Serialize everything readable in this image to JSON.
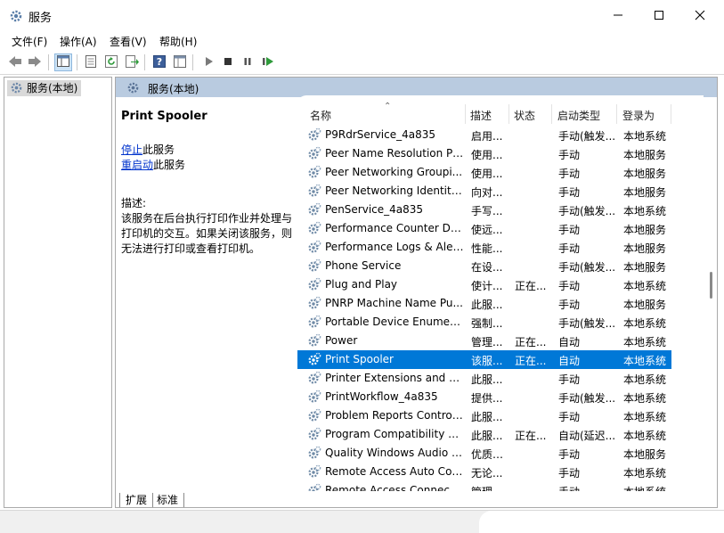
{
  "window": {
    "title": "服务",
    "minimize_icon": "minimize-icon",
    "maximize_icon": "maximize-icon",
    "close_icon": "close-icon"
  },
  "menu": [
    {
      "label": "文件(F)"
    },
    {
      "label": "操作(A)"
    },
    {
      "label": "查看(V)"
    },
    {
      "label": "帮助(H)"
    }
  ],
  "toolbar": {
    "icons": [
      "back-icon",
      "forward-icon",
      "console-tree-icon",
      "properties-icon",
      "refresh-icon",
      "export-icon",
      "help-icon",
      "view-icon",
      "start-icon",
      "stop-icon",
      "pause-icon",
      "restart-icon"
    ]
  },
  "tree": {
    "root_label": "服务(本地)"
  },
  "pane": {
    "header_title": "服务(本地)"
  },
  "description": {
    "service_name": "Print Spooler",
    "stop_link": "停止",
    "stop_suffix": "此服务",
    "restart_link": "重启动",
    "restart_suffix": "此服务",
    "desc_label": "描述:",
    "desc_lines": [
      "该服务在后台执行打印作业并处理与",
      "打印机的交互。如果关闭该服务，则",
      "无法进行打印或查看打印机。"
    ]
  },
  "columns": {
    "name": "名称",
    "description": "描述",
    "status": "状态",
    "startup": "启动类型",
    "logon": "登录为"
  },
  "services": [
    {
      "name": "P9RdrService_4a835",
      "desc": "启用...",
      "status": "",
      "startup": "手动(触发...",
      "logon": "本地系统"
    },
    {
      "name": "Peer Name Resolution Pr...",
      "desc": "使用...",
      "status": "",
      "startup": "手动",
      "logon": "本地服务"
    },
    {
      "name": "Peer Networking Groupi...",
      "desc": "使用...",
      "status": "",
      "startup": "手动",
      "logon": "本地服务"
    },
    {
      "name": "Peer Networking Identity...",
      "desc": "向对...",
      "status": "",
      "startup": "手动",
      "logon": "本地服务"
    },
    {
      "name": "PenService_4a835",
      "desc": "手写...",
      "status": "",
      "startup": "手动(触发...",
      "logon": "本地系统"
    },
    {
      "name": "Performance Counter DL...",
      "desc": "使远...",
      "status": "",
      "startup": "手动",
      "logon": "本地服务"
    },
    {
      "name": "Performance Logs & Aler...",
      "desc": "性能...",
      "status": "",
      "startup": "手动",
      "logon": "本地服务"
    },
    {
      "name": "Phone Service",
      "desc": "在设...",
      "status": "",
      "startup": "手动(触发...",
      "logon": "本地服务"
    },
    {
      "name": "Plug and Play",
      "desc": "使计...",
      "status": "正在...",
      "startup": "手动",
      "logon": "本地系统"
    },
    {
      "name": "PNRP Machine Name Pu...",
      "desc": "此服...",
      "status": "",
      "startup": "手动",
      "logon": "本地服务"
    },
    {
      "name": "Portable Device Enumera...",
      "desc": "强制...",
      "status": "",
      "startup": "手动(触发...",
      "logon": "本地系统"
    },
    {
      "name": "Power",
      "desc": "管理...",
      "status": "正在...",
      "startup": "自动",
      "logon": "本地系统"
    },
    {
      "name": "Print Spooler",
      "desc": "该服...",
      "status": "正在...",
      "startup": "自动",
      "logon": "本地系统",
      "selected": true
    },
    {
      "name": "Printer Extensions and N...",
      "desc": "此服...",
      "status": "",
      "startup": "手动",
      "logon": "本地系统"
    },
    {
      "name": "PrintWorkflow_4a835",
      "desc": "提供...",
      "status": "",
      "startup": "手动(触发...",
      "logon": "本地系统"
    },
    {
      "name": "Problem Reports Control...",
      "desc": "此服...",
      "status": "",
      "startup": "手动",
      "logon": "本地系统"
    },
    {
      "name": "Program Compatibility A...",
      "desc": "此服...",
      "status": "正在...",
      "startup": "自动(延迟...",
      "logon": "本地系统"
    },
    {
      "name": "Quality Windows Audio V...",
      "desc": "优质 ...",
      "status": "",
      "startup": "手动",
      "logon": "本地服务"
    },
    {
      "name": "Remote Access Auto Con...",
      "desc": "无论...",
      "status": "",
      "startup": "手动",
      "logon": "本地系统"
    },
    {
      "name": "Remote Access Connecti...",
      "desc": "管理...",
      "status": "",
      "startup": "手动",
      "logon": "本地系统"
    }
  ],
  "tabs": [
    {
      "label": "扩展"
    },
    {
      "label": "标准"
    }
  ],
  "colors": {
    "selection": "#0078d7",
    "pane_header": "#b9cbe0",
    "link": "#0033cc"
  }
}
